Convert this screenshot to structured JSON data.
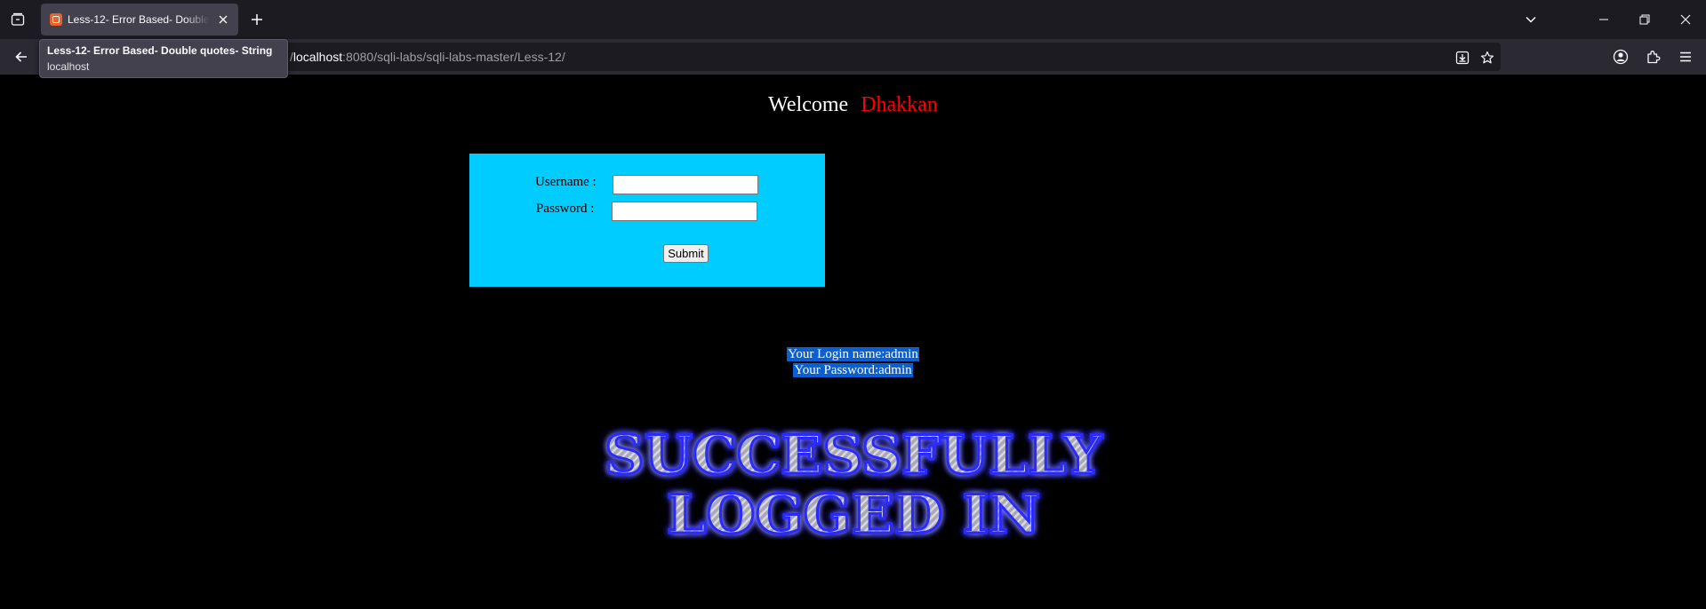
{
  "browser": {
    "tab": {
      "title": "Less-12- Error Based- Double quotes- String",
      "close_label": "×"
    },
    "tooltip": {
      "title": "Less-12- Error Based- Double quotes- String",
      "host": "localhost"
    },
    "url": {
      "prefix": "/",
      "host": "localhost",
      "path": ":8080/sqli-labs/sqli-labs-master/Less-12/"
    }
  },
  "page": {
    "welcome": {
      "label": "Welcome",
      "name": "Dhakkan"
    },
    "form": {
      "username_label": "Username :",
      "password_label": "Password :",
      "username_value": "",
      "password_value": "",
      "submit_label": "Submit"
    },
    "result": {
      "login_name_line": "Your Login name:admin",
      "password_line": "Your Password:admin"
    },
    "banner": {
      "line1": "SUCCESSFULLY",
      "line2": "LOGGED IN"
    }
  },
  "colors": {
    "page_background": "#000000",
    "form_background": "#00ccff",
    "welcome_name": "#ff0000",
    "selection_highlight": "#0a5fd1",
    "banner_glow": "#2a2aff"
  }
}
